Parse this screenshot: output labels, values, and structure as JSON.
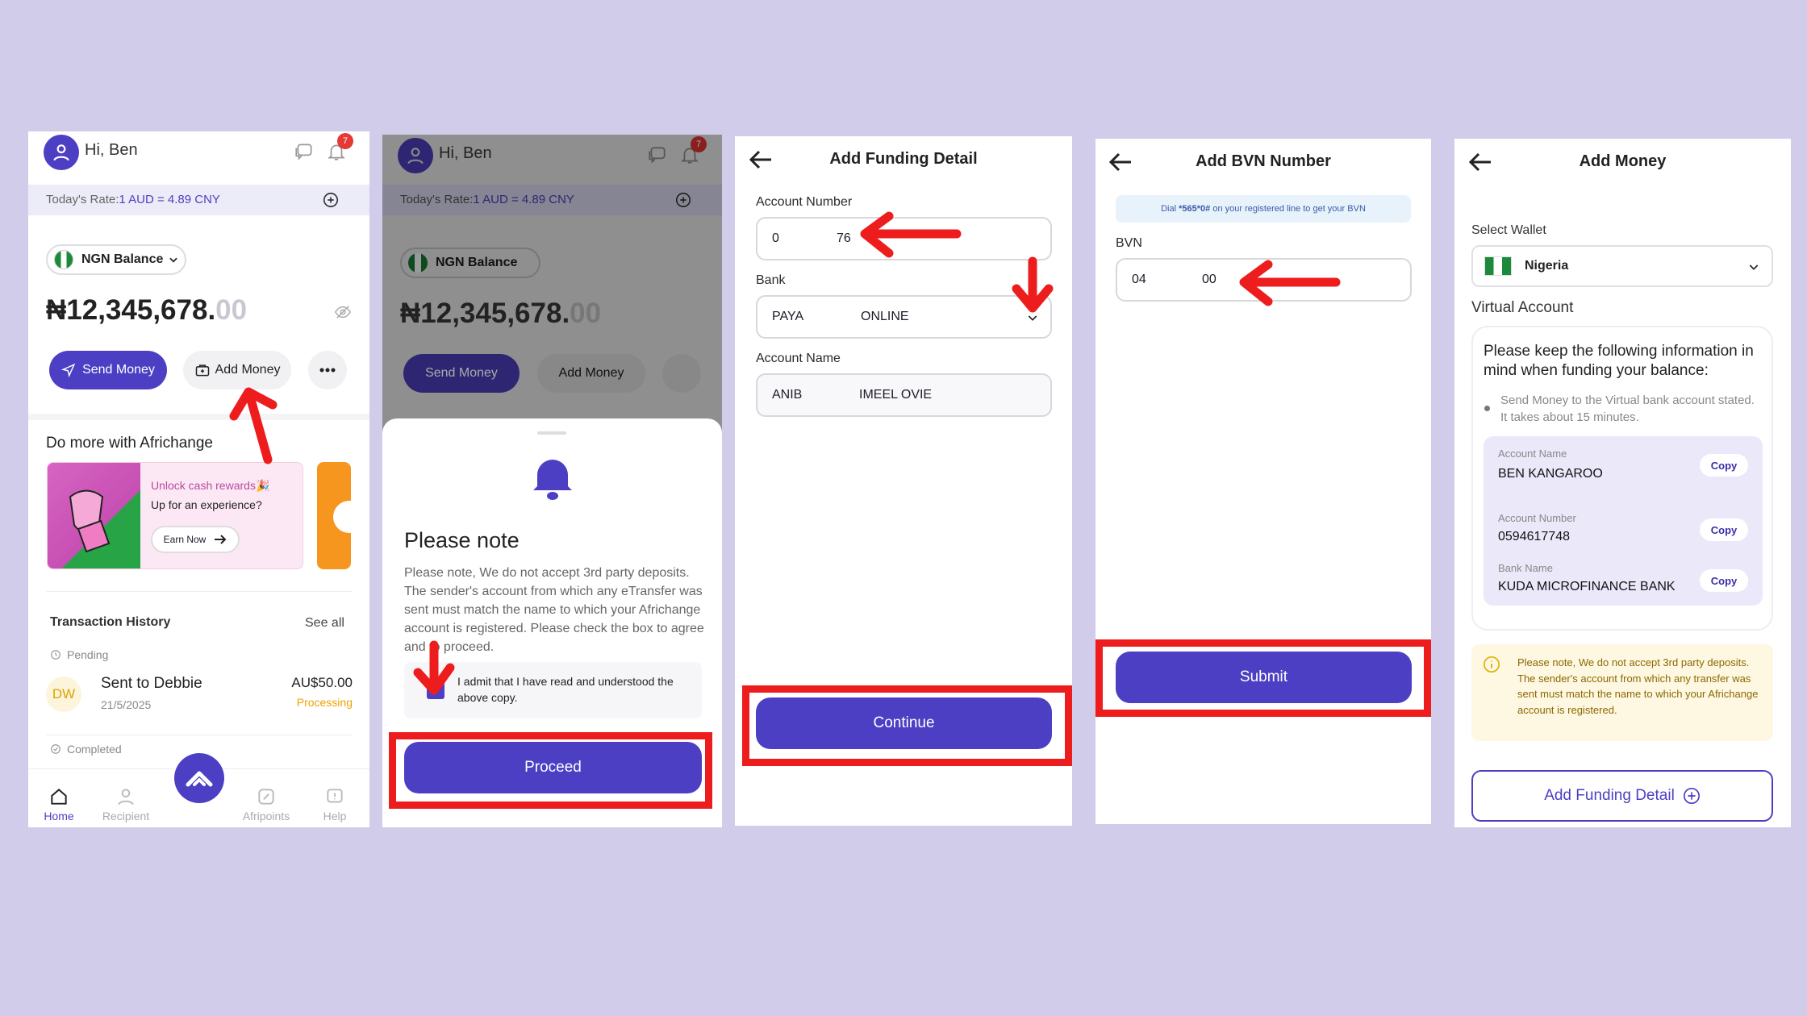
{
  "colors": {
    "background": "#d0cce9",
    "primary": "#4c3fc4",
    "highlight_red": "#ee1d1d",
    "processing": "#f2a100"
  },
  "screen1": {
    "greeting": "Hi, Ben",
    "notification_count": "7",
    "rate_prefix": "Today's Rate:",
    "rate_value": "1 AUD = 4.89 CNY",
    "wallet_selector": "NGN Balance",
    "balance_main": "₦12,345,678.",
    "balance_decimals": "00",
    "send_money": "Send Money",
    "add_money": "Add Money",
    "promo_heading": "Do more with Africhange",
    "promo_line1": "Unlock cash rewards🎉",
    "promo_line2": "Up for an experience?",
    "promo_button": "Earn Now",
    "transactions_title": "Transaction History",
    "see_all": "See all",
    "pending_label": "Pending",
    "tx_initials": "DW",
    "tx_title": "Sent to Debbie",
    "tx_date": "21/5/2025",
    "tx_amount": "AU$50.00",
    "tx_status": "Processing",
    "completed_label": "Completed",
    "nav": {
      "home": "Home",
      "recipient": "Recipient",
      "afripoints": "Afripoints",
      "help": "Help"
    }
  },
  "screen2": {
    "greeting": "Hi, Ben",
    "notification_count": "7",
    "rate_prefix": "Today's Rate:",
    "rate_value": "1 AUD = 4.89 CNY",
    "wallet_selector": "NGN Balance",
    "balance_main": "₦12,345,678.",
    "balance_decimals": "00",
    "send_money": "Send Money",
    "add_money": "Add Money",
    "sheet_title": "Please note",
    "sheet_body": "Please note, We do not accept 3rd party deposits. The sender's account from which any eTransfer was sent must match the name to which your Africhange account is registered. Please check the box to agree and to proceed.",
    "agree_text": "I admit that I have read and understood the above copy.",
    "proceed": "Proceed"
  },
  "screen3": {
    "title": "Add Funding Detail",
    "account_number_label": "Account Number",
    "account_number_a": "0",
    "account_number_b": "76",
    "bank_label": "Bank",
    "bank_value_a": "PAYA",
    "bank_value_b": "ONLINE",
    "account_name_label": "Account Name",
    "account_name_a": "ANIB",
    "account_name_b": "IMEEL OVIE",
    "continue": "Continue"
  },
  "screen4": {
    "title": "Add BVN Number",
    "dial_hint_pre": "Dial ",
    "dial_code": "*565*0#",
    "dial_hint_post": " on your registered line to get your BVN",
    "bvn_label": "BVN",
    "bvn_a": "04",
    "bvn_b": "00",
    "submit": "Submit"
  },
  "screen5": {
    "title": "Add Money",
    "select_wallet_label": "Select Wallet",
    "wallet": "Nigeria",
    "virtual_account_label": "Virtual Account",
    "info_heading": "Please keep the following information in mind when funding your balance:",
    "info_bullet": "Send Money to the Virtual bank account stated. It takes about 15 minutes.",
    "account_name_label": "Account Name",
    "account_name": "BEN KANGAROO",
    "account_number_label": "Account Number",
    "account_number": "0594617748",
    "bank_name_label": "Bank Name",
    "bank_name": "KUDA MICROFINANCE BANK",
    "copy": "Copy",
    "notice": "Please note, We do not accept 3rd party deposits. The sender's account from which any transfer was sent must match the name to which your Africhange account is registered.",
    "add_funding_detail": "Add Funding Detail"
  }
}
